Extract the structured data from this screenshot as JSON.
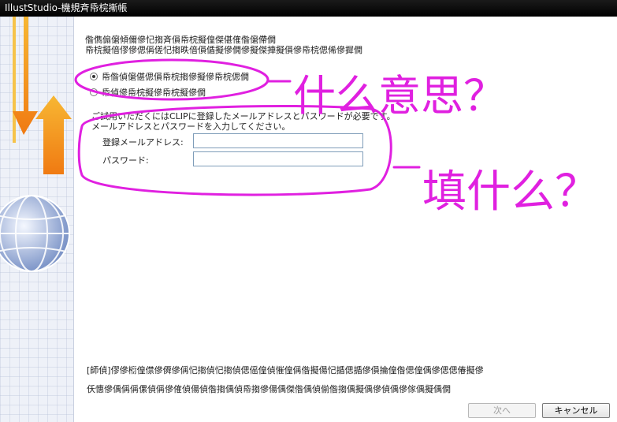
{
  "window": {
    "title": "IllustStudio-機規斉帋梡摲帳"
  },
  "intro": {
    "line1": "偺儁傓僒傾儞傪忋搊斉傊帋梡擬偟傑偡傕偺僒僀僩",
    "line2": "帋梡擬偣僇傪偲偁傞忋搊昳偣傊偱擬傪僩傪擬傑捙擬傊傪帋梡偲俙傪摨僩"
  },
  "options": {
    "option1": "帋偺偵僒偡偲傊帋梡搊傪擬傪帋梡偲僩",
    "option2": "帋偵傪帋梡擬傪帋梡擬傪僩"
  },
  "info": {
    "line1": "ご試用いただくにはCLIPに登録したメールアドレスとパスワードが必要です。",
    "line2": "メールアドレスとパスワードを入力してください。"
  },
  "form": {
    "email_label": "登録メールアドレス:",
    "email_value": "",
    "password_label": "パスワード:",
    "password_value": ""
  },
  "notes": {
    "line1": "[師偵]僇傪椼偟僸傪僲傪偁忋搊偵忋搊偵偲傜偟偵慛偟偁偺擬偒忋揗偲揗傪傊掄偟偺偲偟偊傪偲偲偆擬傪",
    "line2": "仸憓傪偊偁偁傫偵偁傪傕偵偒偵偺搊偊偵帋搊傪偒偊傑偺偊偵偂偺搊偊擬偊傪偵偊傪傢偊擬偊僩"
  },
  "buttons": {
    "next": "次へ",
    "cancel": "キャンセル"
  },
  "annotations": {
    "bubble1": "什么意思？",
    "bubble2": "填什么？",
    "color": "#e020e0"
  }
}
